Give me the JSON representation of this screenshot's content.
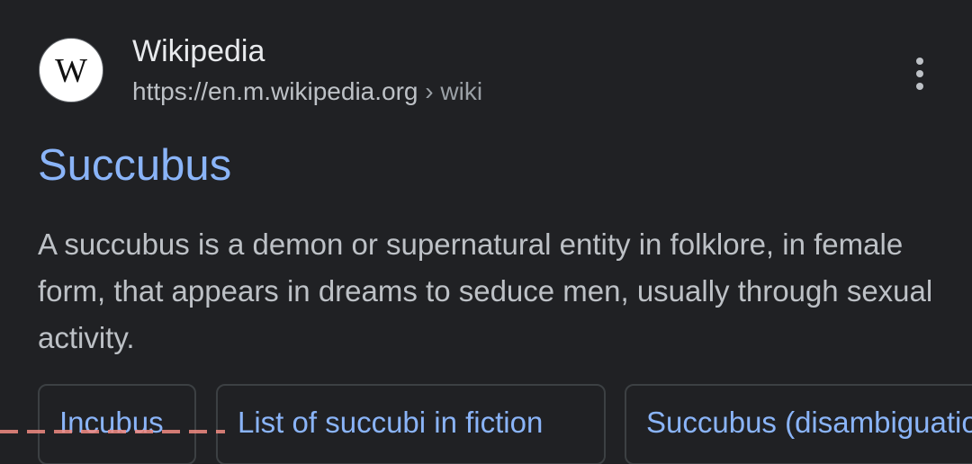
{
  "source": {
    "favicon_letter": "W",
    "favicon_icon": "wikipedia-icon",
    "name": "Wikipedia",
    "url": "https://en.m.wikipedia.org",
    "breadcrumb": " › wiki"
  },
  "menu": {
    "icon": "more-vert-icon"
  },
  "result": {
    "title": "Succubus",
    "snippet": "A succubus is a demon or supernatural entity in folklore, in female form, that appears in dreams to seduce men, usually through sexual activity."
  },
  "chips": [
    {
      "label": "Incubus"
    },
    {
      "label": "List of succubi in fiction"
    },
    {
      "label": "Succubus (disambiguation)"
    }
  ],
  "colors": {
    "background": "#202124",
    "link": "#8ab4f8",
    "text": "#bdc1c6",
    "heading": "#e8eaed",
    "highlight": "#f28b82"
  }
}
